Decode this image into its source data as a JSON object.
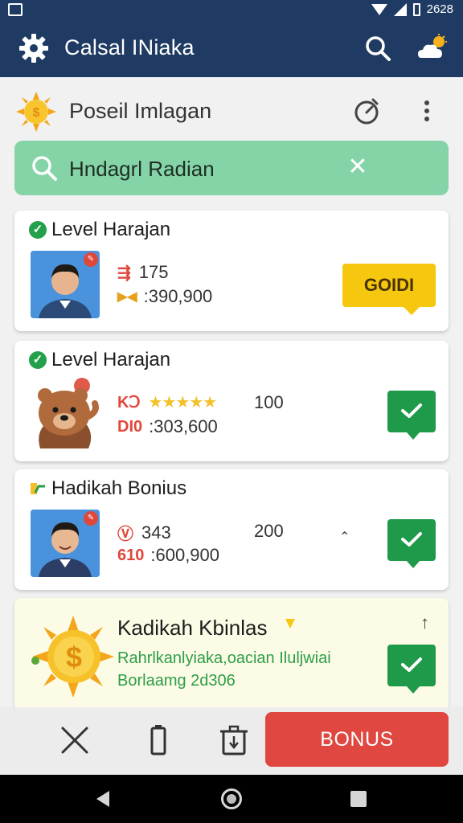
{
  "status_bar": {
    "time": "2628"
  },
  "app_bar": {
    "title": "Calsal INiaka",
    "left_icon": "gear-icon",
    "right_icons": [
      "search-icon",
      "weather-icon"
    ]
  },
  "header": {
    "title": "Poseil Imlagan",
    "icons": [
      "sun-logo-icon",
      "timer-icon",
      "more-vert-icon"
    ]
  },
  "search": {
    "value": "Hndagrl Radian"
  },
  "cards": [
    {
      "title": "Level Harajan",
      "stat1": "175",
      "stat2": ":390,900",
      "action_label": "GOIDI"
    },
    {
      "title": "Level Harajan",
      "stat1": "100",
      "stat2_prefix": "DI0",
      "stat2": ":303,600"
    },
    {
      "title": "Hadikah Bonius",
      "stat1": "343",
      "stat1b": "200",
      "stat2_prefix": "610",
      "stat2": ":600,900"
    }
  ],
  "promo": {
    "title": "Kadikah Kbinlas",
    "line1": "Rahrlkanlyiaka,oacian Iluljwiai",
    "line2": "Borlaamg 2d306"
  },
  "bottom_bar": {
    "bonus_label": "BONUS",
    "icons": [
      "close-icon",
      "battery-icon",
      "trash-icon"
    ]
  },
  "colors": {
    "app_bar": "#1f3b63",
    "search_bg": "#85d4a7",
    "accent_green": "#1f9a4a",
    "gold": "#f6c70f",
    "bonus_red": "#df4740"
  }
}
